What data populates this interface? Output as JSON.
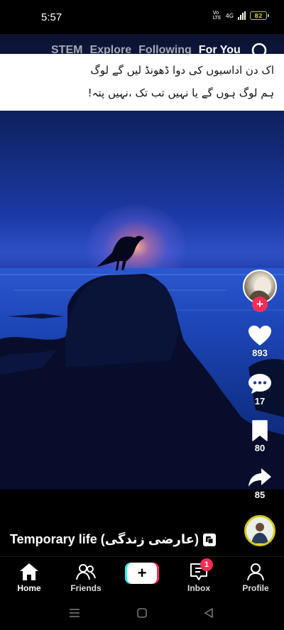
{
  "status_bar": {
    "time": "5:57",
    "network_label": "4G",
    "volte_label": "Vo LTE",
    "battery": "82"
  },
  "top_tabs": [
    {
      "label": "STEM",
      "active": false
    },
    {
      "label": "Explore",
      "active": false
    },
    {
      "label": "Following",
      "active": false
    },
    {
      "label": "For You",
      "active": true
    }
  ],
  "caption_overlay": {
    "line1": "اک دن اداسیوں کی دوا ڈھونڈ لیں گے لوگ",
    "line2": "ہم لوگ ہوں گے یا نہیں تب تک ،نہیں پتہ!"
  },
  "actions": {
    "likes": "893",
    "comments": "17",
    "saves": "80",
    "shares": "85"
  },
  "video_caption": {
    "text": "Temporary life (عارضی زندگی)"
  },
  "bottom_nav": {
    "home": "Home",
    "friends": "Friends",
    "inbox": "Inbox",
    "inbox_badge": "1",
    "profile": "Profile"
  },
  "colors": {
    "accent": "#fe2c55",
    "cyan": "#25f4ee",
    "battery": "#c9c24a"
  }
}
